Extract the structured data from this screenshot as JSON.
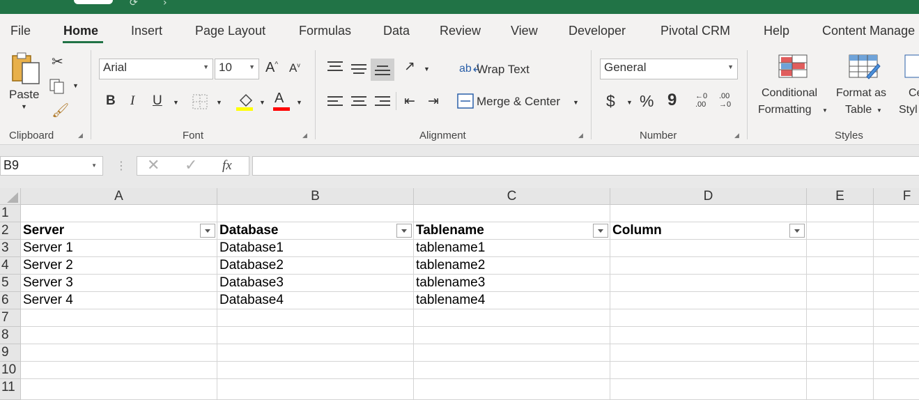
{
  "ribbon_tabs": [
    "File",
    "Home",
    "Insert",
    "Page Layout",
    "Formulas",
    "Data",
    "Review",
    "View",
    "Developer",
    "Pivotal CRM",
    "Help",
    "Content Manage"
  ],
  "clipboard": {
    "paste_label": "Paste",
    "group_label": "Clipboard"
  },
  "font": {
    "name": "Arial",
    "size": "10",
    "bold": "B",
    "italic": "I",
    "underline": "U",
    "grow": "A",
    "shrink": "A",
    "font_color": "A",
    "group_label": "Font"
  },
  "alignment": {
    "wrap_text": "Wrap Text",
    "merge_center": "Merge & Center",
    "group_label": "Alignment"
  },
  "number": {
    "format": "General",
    "currency": "$",
    "percent": "%",
    "comma": "9",
    "inc_decimal": "←0\n.00",
    "dec_decimal": ".00\n→0",
    "group_label": "Number"
  },
  "styles": {
    "conditional_line1": "Conditional",
    "conditional_line2": "Formatting",
    "format_table_line1": "Format as",
    "format_table_line2": "Table",
    "cell_styles_line1": "Ce",
    "cell_styles_line2": "Styl",
    "group_label": "Styles"
  },
  "formula_bar": {
    "name_box": "B9",
    "fx": "fx",
    "value": ""
  },
  "columns": [
    "A",
    "B",
    "C",
    "D",
    "E",
    "F"
  ],
  "rows": [
    "1",
    "2",
    "3",
    "4",
    "5",
    "6",
    "7",
    "8",
    "9",
    "10",
    "11"
  ],
  "table": {
    "headers": [
      "Server",
      "Database",
      "Tablename",
      "Column"
    ],
    "data": [
      [
        "Server 1",
        "Database1",
        "tablename1",
        ""
      ],
      [
        "Server 2",
        "Database2",
        "tablename2",
        ""
      ],
      [
        "Server 3",
        "Database3",
        "tablename3",
        ""
      ],
      [
        "Server 4",
        "Database4",
        "tablename4",
        ""
      ]
    ]
  },
  "colors": {
    "accent": "#217346",
    "ribbon_bg": "#f3f2f1",
    "highlight_yellow": "#ffff00",
    "font_red": "#ff0000"
  },
  "icons": [
    "cut-icon",
    "copy-icon",
    "format-painter-icon",
    "borders-icon",
    "fill-color-icon",
    "orientation-icon",
    "wrap-text-icon",
    "merge-icon",
    "conditional-formatting-icon",
    "format-as-table-icon",
    "cancel-icon",
    "enter-icon"
  ]
}
